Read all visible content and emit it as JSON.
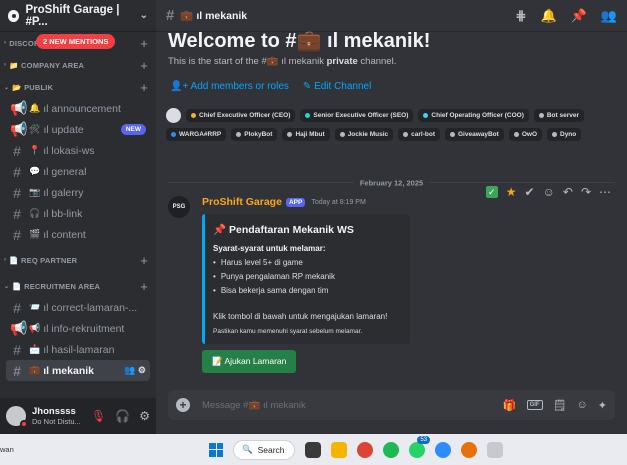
{
  "server": {
    "name": "ProShift Garage | #P...",
    "mention_pill": "2 NEW MENTIONS"
  },
  "sidebar": {
    "categories": [
      {
        "label": "DISCORD",
        "emoji": ""
      },
      {
        "label": "COMPANY AREA",
        "emoji": "📁"
      },
      {
        "label": "PUBLIK",
        "emoji": "📂"
      },
      {
        "label": "REQ PARTNER",
        "emoji": "📄"
      },
      {
        "label": "RECRUITMEN AREA",
        "emoji": "📄"
      }
    ],
    "publik_channels": [
      {
        "emoji": "🔔",
        "name": "ıl announcement",
        "tag": ""
      },
      {
        "emoji": "🛠",
        "name": "ıl update",
        "tag": "NEW"
      },
      {
        "emoji": "📍",
        "name": "ıl lokasi-ws",
        "tag": ""
      },
      {
        "emoji": "💬",
        "name": "ıl general",
        "tag": ""
      },
      {
        "emoji": "📷",
        "name": "ıl galerry",
        "tag": ""
      },
      {
        "emoji": "🎧",
        "name": "ıl bb-link",
        "tag": ""
      },
      {
        "emoji": "🎬",
        "name": "ıl content",
        "tag": ""
      }
    ],
    "recruit_channels": [
      {
        "emoji": "📨",
        "name": "ıl correct-lamaran-...",
        "active": false
      },
      {
        "emoji": "📢",
        "name": "ıl info-rekruitment",
        "active": false
      },
      {
        "emoji": "📩",
        "name": "ıl hasil-lamaran",
        "active": false
      },
      {
        "emoji": "💼",
        "name": "ıl mekanik",
        "active": true
      }
    ]
  },
  "user": {
    "name": "Jhonssss",
    "status": "Do Not Distu..."
  },
  "channel": {
    "emoji": "💼",
    "name": "ıl mekanik"
  },
  "welcome": {
    "title": "Welcome to #💼 ıl mekanik!",
    "sub_prefix": "This is the start of the #💼 ıl mekanik ",
    "sub_bold": "private",
    "sub_suffix": " channel.",
    "add_members": "Add members or roles",
    "edit_channel": "Edit Channel"
  },
  "roles": [
    {
      "name": "Chief Executive Officer (CEO)",
      "color": "#f0b232"
    },
    {
      "name": "Senior Executive Officer (SEO)",
      "color": "#23d5c8"
    },
    {
      "name": "Chief Operating Officer (COO)",
      "color": "#3fd6e8"
    },
    {
      "name": "Bot server",
      "color": "#b5bac1"
    },
    {
      "name": "WARGA#RRP",
      "color": "#3a8be8"
    },
    {
      "name": "PlokyBot",
      "color": "#b5bac1"
    },
    {
      "name": "Haji Mbut",
      "color": "#b5bac1"
    },
    {
      "name": "Jockie Music",
      "color": "#b5bac1"
    },
    {
      "name": "carl-bot",
      "color": "#b5bac1"
    },
    {
      "name": "GiveawayBot",
      "color": "#b5bac1"
    },
    {
      "name": "OwO",
      "color": "#b5bac1"
    },
    {
      "name": "Dyno",
      "color": "#b5bac1"
    }
  ],
  "date_divider": "February 12, 2025",
  "message": {
    "avatar_text": "PSG",
    "author": "ProShift Garage",
    "app_tag": "APP",
    "time": "Today at 8:19 PM",
    "embed": {
      "title": "📌 Pendaftaran Mekanik WS",
      "subtitle": "Syarat-syarat untuk melamar:",
      "items": [
        "Harus level 5+ di game",
        "Punya pengalaman RP mekanik",
        "Bisa bekerja sama dengan tim"
      ],
      "p1": "Klik tombol di bawah untuk mengajukan lamaran!",
      "p2": "Pastikan kamu memenuhi syarat sebelum melamar."
    },
    "button": "📝 Ajukan Lamaran"
  },
  "composer": {
    "placeholder": "Message #💼 ıl mekanik"
  },
  "taskbar": {
    "weather": "wan",
    "search": "Search",
    "whatsapp_badge": "53"
  },
  "colors": {
    "accent": "#5865f2",
    "link": "#00a8fc",
    "author": "#faa61a",
    "success": "#248046"
  }
}
